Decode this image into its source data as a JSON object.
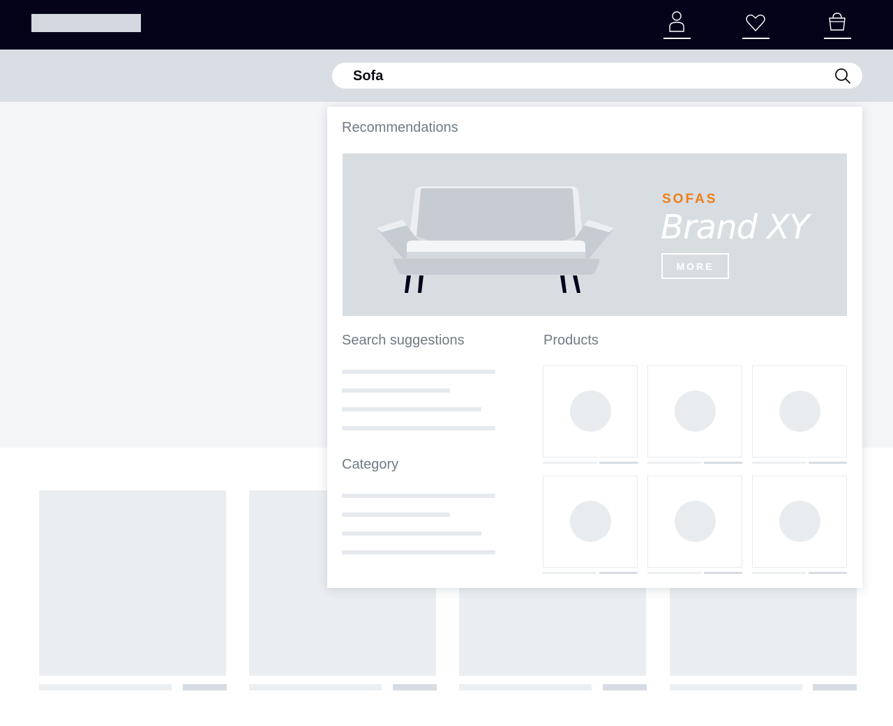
{
  "header": {
    "logo_placeholder": "site-logo",
    "icons": [
      "account-icon",
      "wishlist-heart-icon",
      "shopping-bag-icon"
    ]
  },
  "search": {
    "value": "Sofa",
    "icon": "search-icon"
  },
  "dropdown": {
    "recommendations_title": "Recommendations",
    "banner": {
      "eyebrow": "SOFAS",
      "brand": "Brand XY",
      "button_label": "MORE",
      "image": "sofa-illustration"
    },
    "search_suggestions_title": "Search suggestions",
    "category_title": "Category",
    "products_title": "Products"
  },
  "colors": {
    "nav_background": "#05031a",
    "accent_orange": "#f07d13",
    "search_band": "#d8dee3",
    "banner_background": "#d8dde2",
    "section_title": "#707b86"
  }
}
